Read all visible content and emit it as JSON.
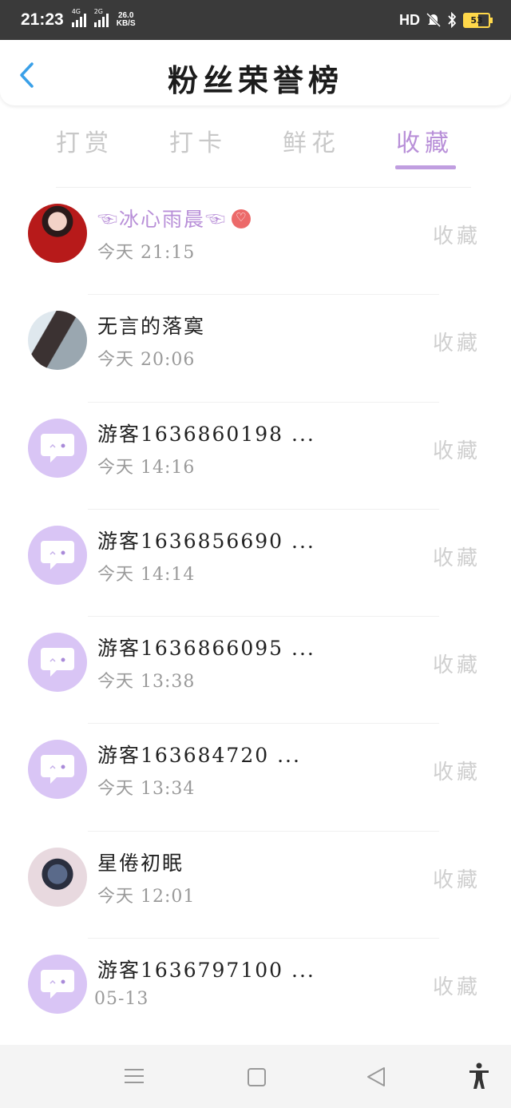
{
  "status_bar": {
    "time": "21:23",
    "net1": "4G",
    "net2": "2G",
    "speed_value": "26.0",
    "speed_unit": "KB/S",
    "hd": "HD",
    "battery": "53"
  },
  "header": {
    "title": "粉丝荣誉榜"
  },
  "tabs": [
    {
      "label": "打赏",
      "active": false
    },
    {
      "label": "打卡",
      "active": false
    },
    {
      "label": "鲜花",
      "active": false
    },
    {
      "label": "收藏",
      "active": true
    }
  ],
  "rows": [
    {
      "name": "☜冰心雨晨☜",
      "time": "今天 21:15",
      "action": "收藏",
      "avatar": "photo-red",
      "vip": true
    },
    {
      "name": "无言的落寞",
      "time": "今天 20:06",
      "action": "收藏",
      "avatar": "photo-girl",
      "vip": false
    },
    {
      "name": "游客1636860198 ...",
      "time": "今天 14:16",
      "action": "收藏",
      "avatar": "guest",
      "vip": false
    },
    {
      "name": "游客1636856690 ...",
      "time": "今天 14:14",
      "action": "收藏",
      "avatar": "guest",
      "vip": false
    },
    {
      "name": "游客1636866095 ...",
      "time": "今天 13:38",
      "action": "收藏",
      "avatar": "guest",
      "vip": false
    },
    {
      "name": "游客163684720 ...",
      "time": "今天 13:34",
      "action": "收藏",
      "avatar": "guest",
      "vip": false
    },
    {
      "name": "星倦初眠",
      "time": "今天 12:01",
      "action": "收藏",
      "avatar": "photo-boy",
      "vip": false
    },
    {
      "name": "游客1636797100 ...",
      "time": "05-13",
      "action": "收藏",
      "avatar": "guest",
      "vip": false
    }
  ],
  "colors": {
    "accent": "#b88fd8",
    "guest_avatar": "#d9c5f5",
    "inactive_tab": "#c8c8c8",
    "status_bar": "#3a3a3a"
  }
}
